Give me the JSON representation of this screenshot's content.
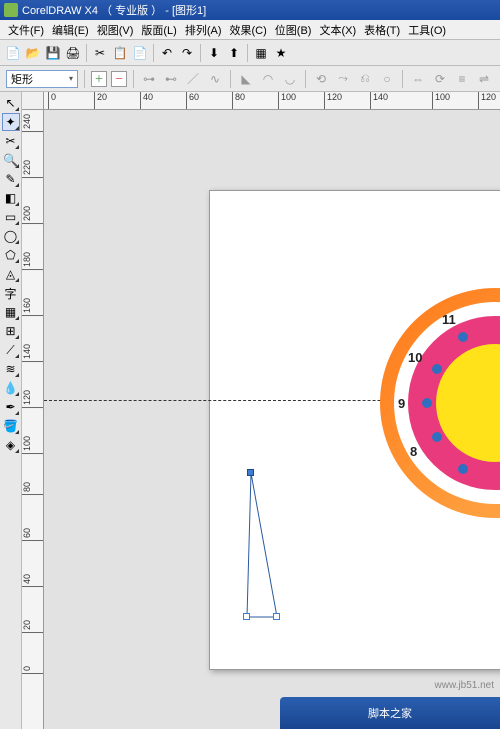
{
  "title": "CorelDRAW X4 （ 专业版 ） - [图形1]",
  "menu": {
    "file": "文件(F)",
    "edit": "编辑(E)",
    "view": "视图(V)",
    "layout": "版面(L)",
    "arrange": "排列(A)",
    "effects": "效果(C)",
    "bitmap": "位图(B)",
    "text": "文本(X)",
    "table": "表格(T)",
    "tools": "工具(O)"
  },
  "propbar": {
    "shape_label": "矩形"
  },
  "ruler": {
    "h_ticks": [
      "0",
      "20",
      "40",
      "60",
      "80",
      "100",
      "120",
      "140",
      "100",
      "120"
    ],
    "v_ticks": [
      "240",
      "220",
      "200",
      "180",
      "160",
      "140",
      "120",
      "100",
      "80",
      "60",
      "40",
      "20",
      "0"
    ]
  },
  "clock": {
    "numbers": [
      "11",
      "10",
      "9",
      "8"
    ],
    "colors": {
      "outer": "#ff7a1a",
      "mid": "#e83a7c",
      "inner": "#ffe21a",
      "dots": "#2f6fbf"
    }
  },
  "watermark": "www.jb51.net",
  "footer": "脚本之家"
}
